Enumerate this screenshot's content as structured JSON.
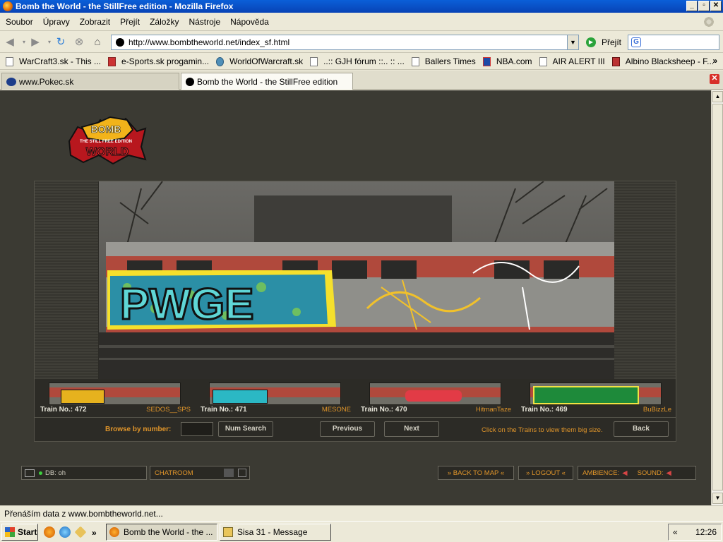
{
  "window": {
    "title": "Bomb the World - the StillFree edition - Mozilla Firefox"
  },
  "menu": [
    "Soubor",
    "Úpravy",
    "Zobrazit",
    "Přejít",
    "Záložky",
    "Nástroje",
    "Nápověda"
  ],
  "nav": {
    "url": "http://www.bombtheworld.net/index_sf.html",
    "go_label": "Přejít"
  },
  "bookmarks": [
    "WarCraft3.sk - This ...",
    "e-Sports.sk progamin...",
    "WorldOfWarcraft.sk",
    "..:: GJH fórum ::.. :: ...",
    "Ballers Times",
    "NBA.com",
    "AIR ALERT III",
    "Albino Blacksheep - F..."
  ],
  "bookmarks_more": "»",
  "tabs": [
    {
      "label": "www.Pokec.sk"
    },
    {
      "label": "Bomb the World - the StillFree edition"
    }
  ],
  "page": {
    "logo": {
      "line1": "BOMB",
      "line2": "THE STILL FREE EDITION",
      "line3": "WORLD"
    },
    "trains": [
      {
        "number": "Train No.: 472",
        "author": "SEDOS__SPS",
        "color": "#e6b21e"
      },
      {
        "number": "Train No.: 471",
        "author": "MESONE",
        "color": "#2bb8c4"
      },
      {
        "number": "Train No.: 470",
        "author": "HitmanTaze",
        "color": "#e23b46"
      },
      {
        "number": "Train No.: 469",
        "author": "BuBizzLe",
        "color": "#1e8a3a"
      }
    ],
    "controls": {
      "browse_label": "Browse by number:",
      "num_search": "Num Search",
      "previous": "Previous",
      "next": "Next",
      "hint": "Click on the Trains to view them big size.",
      "back": "Back"
    },
    "bottom": {
      "db_status": "DB: oh",
      "chatroom": "CHATROOM",
      "back_to_map": "» BACK TO MAP «",
      "logout": "» LOGOUT «",
      "ambience": "AMBIENCE:",
      "sound": "SOUND:"
    }
  },
  "status": "Přenáším data z www.bombtheworld.net...",
  "taskbar": {
    "start": "Start",
    "items": [
      {
        "label": "Bomb the World - the ..."
      },
      {
        "label": "Sisa 31 - Message"
      }
    ],
    "tray_arrow": "«",
    "clock": "12:26"
  }
}
